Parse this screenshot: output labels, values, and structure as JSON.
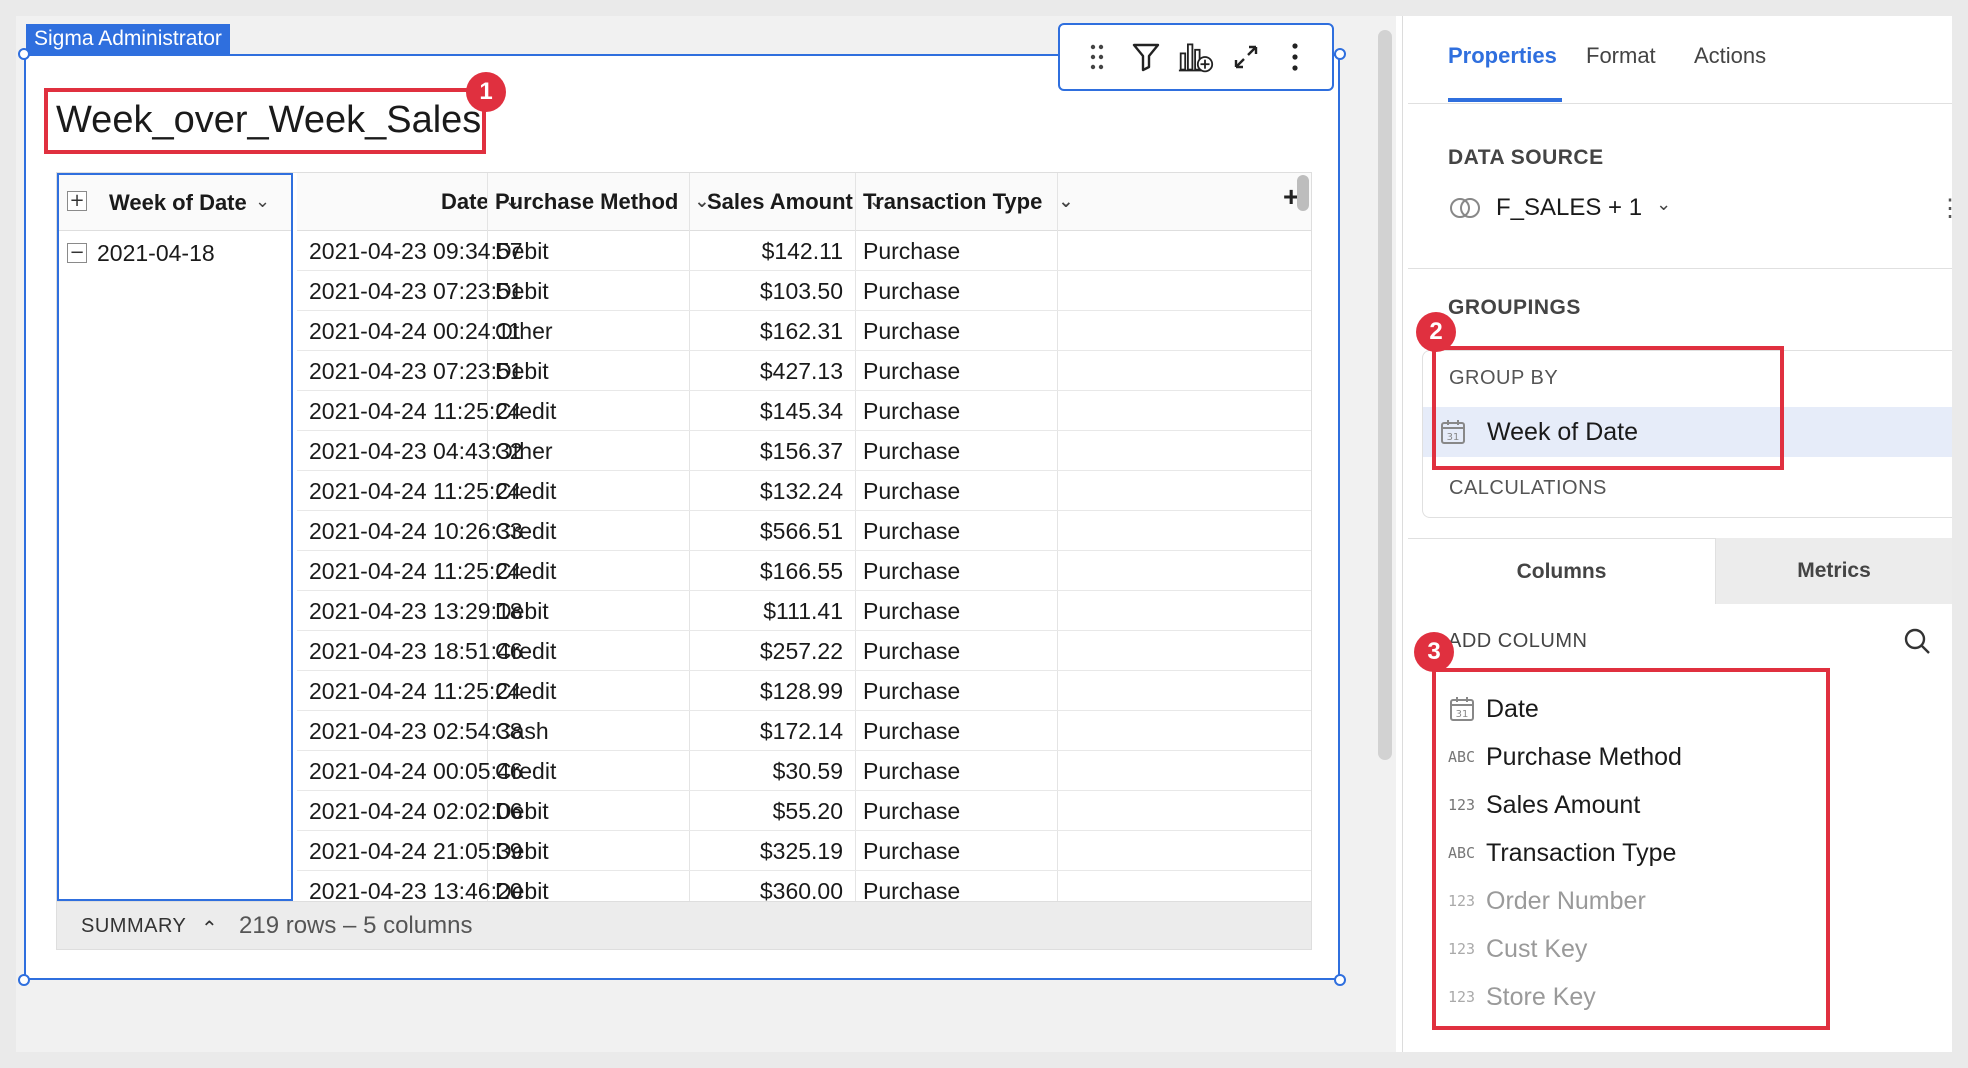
{
  "element_tag": "Sigma Administrator",
  "element_title": "Week_over_Week_Sales",
  "badges": [
    "1",
    "2",
    "3"
  ],
  "toolbar": {
    "icons": [
      "drag-handle-icon",
      "filter-icon",
      "add-chart-icon",
      "expand-icon",
      "more-vertical-icon"
    ]
  },
  "table": {
    "group_column": {
      "label": "Week of Date",
      "value": "2021-04-18"
    },
    "columns": [
      "Date",
      "Purchase Method",
      "Sales Amount",
      "Transaction Type"
    ],
    "rows": [
      [
        "2021-04-23 09:34:57",
        "Debit",
        "$142.11",
        "Purchase"
      ],
      [
        "2021-04-23 07:23:51",
        "Debit",
        "$103.50",
        "Purchase"
      ],
      [
        "2021-04-24 00:24:11",
        "Other",
        "$162.31",
        "Purchase"
      ],
      [
        "2021-04-23 07:23:51",
        "Debit",
        "$427.13",
        "Purchase"
      ],
      [
        "2021-04-24 11:25:24",
        "Credit",
        "$145.34",
        "Purchase"
      ],
      [
        "2021-04-23 04:43:32",
        "Other",
        "$156.37",
        "Purchase"
      ],
      [
        "2021-04-24 11:25:24",
        "Credit",
        "$132.24",
        "Purchase"
      ],
      [
        "2021-04-24 10:26:33",
        "Credit",
        "$566.51",
        "Purchase"
      ],
      [
        "2021-04-24 11:25:24",
        "Credit",
        "$166.55",
        "Purchase"
      ],
      [
        "2021-04-23 13:29:18",
        "Debit",
        "$111.41",
        "Purchase"
      ],
      [
        "2021-04-23 18:51:46",
        "Credit",
        "$257.22",
        "Purchase"
      ],
      [
        "2021-04-24 11:25:24",
        "Credit",
        "$128.99",
        "Purchase"
      ],
      [
        "2021-04-23 02:54:38",
        "Cash",
        "$172.14",
        "Purchase"
      ],
      [
        "2021-04-24 00:05:46",
        "Credit",
        "$30.59",
        "Purchase"
      ],
      [
        "2021-04-24 02:02:06",
        "Debit",
        "$55.20",
        "Purchase"
      ],
      [
        "2021-04-24 21:05:39",
        "Debit",
        "$325.19",
        "Purchase"
      ],
      [
        "2021-04-23 13:46:20",
        "Debit",
        "$360.00",
        "Purchase"
      ]
    ],
    "summary_label": "SUMMARY",
    "summary_info": "219 rows – 5 columns"
  },
  "panel": {
    "tabs": [
      "Properties",
      "Format",
      "Actions"
    ],
    "active_tab": "Properties",
    "data_source_label": "DATA SOURCE",
    "data_source_name": "F_SALES + 1",
    "groupings_label": "GROUPINGS",
    "group_by_label": "GROUP BY",
    "group_by_item": "Week of Date",
    "calculations_label": "CALCULATIONS",
    "column_tabs": [
      "Columns",
      "Metrics"
    ],
    "add_column_label": "ADD COLUMN",
    "columns": [
      {
        "type": "date",
        "name": "Date",
        "active": true
      },
      {
        "type": "ABC",
        "name": "Purchase Method",
        "active": true
      },
      {
        "type": "123",
        "name": "Sales Amount",
        "active": true
      },
      {
        "type": "ABC",
        "name": "Transaction Type",
        "active": true
      },
      {
        "type": "123",
        "name": "Order Number",
        "active": false
      },
      {
        "type": "123",
        "name": "Cust Key",
        "active": false
      },
      {
        "type": "123",
        "name": "Store Key",
        "active": false
      }
    ]
  },
  "colors": {
    "accent": "#2f6fde",
    "callout": "#e0303f",
    "selected_row": "#e6ecf9"
  }
}
